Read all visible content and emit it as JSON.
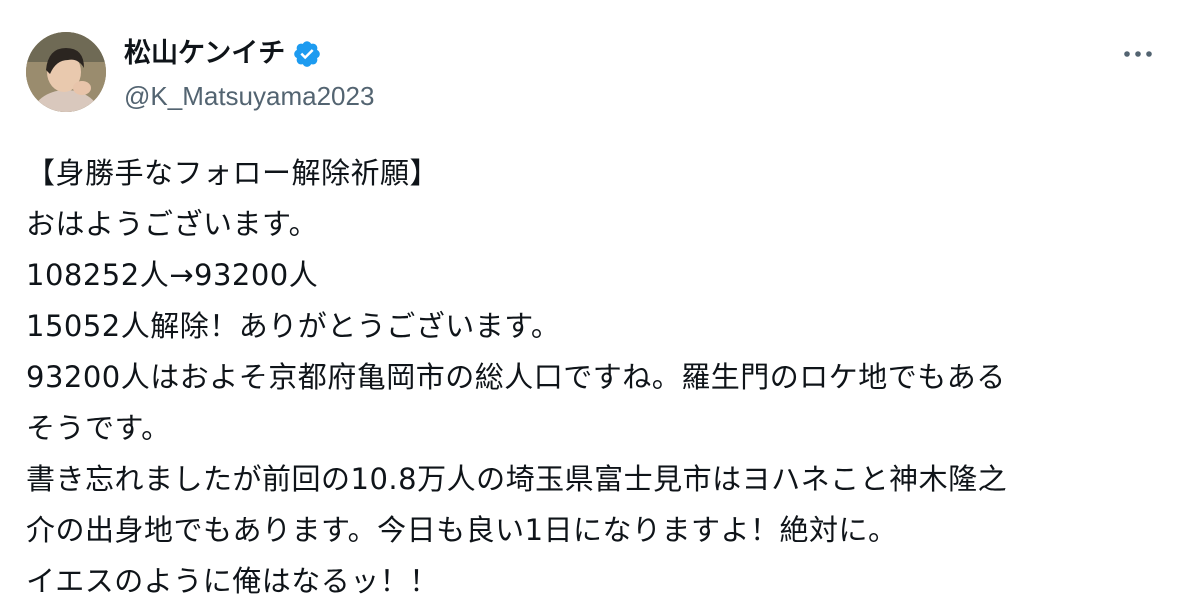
{
  "tweet": {
    "author": {
      "display_name": "松山ケンイチ",
      "handle": "@K_Matsuyama2023",
      "verified": true,
      "verified_color": "#1d9bf0"
    },
    "more_icon": "more-horizontal-icon",
    "text_lines": [
      "【身勝手なフォロー解除祈願】",
      "おはようございます。",
      "108252人→93200人",
      "15052人解除！ありがとうございます。",
      "93200人はおよそ京都府亀岡市の総人口ですね。羅生門のロケ地でもある",
      "そうです。",
      "書き忘れましたが前回の10.8万人の埼玉県富士見市はヨハネこと神木隆之",
      "介の出身地でもあります。今日も良い1日になりますよ！絶対に。",
      "イエスのように俺はなるッ！！"
    ]
  }
}
